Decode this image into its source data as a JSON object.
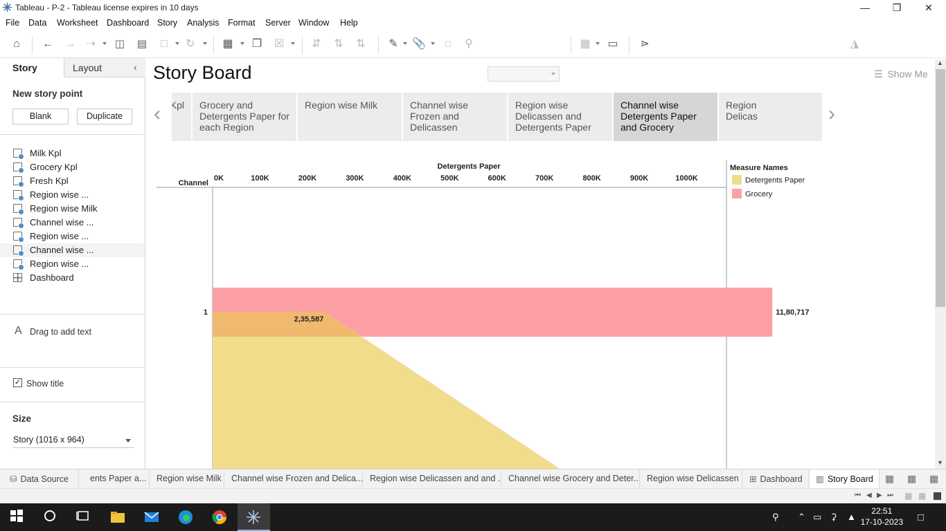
{
  "window": {
    "title": "Tableau - P-2 - Tableau license expires in 10 days",
    "minimize": "—",
    "restore": "❒",
    "close": "✕"
  },
  "menu": [
    "File",
    "Data",
    "Worksheet",
    "Dashboard",
    "Story",
    "Analysis",
    "Format",
    "Server",
    "Window",
    "Help"
  ],
  "toolbar": {
    "show_me_label": "Show Me"
  },
  "left_pane": {
    "tabs": {
      "story": "Story",
      "layout": "Layout"
    },
    "new_story_point": {
      "title": "New story point",
      "blank_label": "Blank",
      "duplicate_label": "Duplicate"
    },
    "sheets": [
      {
        "label": "Milk Kpl",
        "type": "worksheet"
      },
      {
        "label": "Grocery Kpl",
        "type": "worksheet"
      },
      {
        "label": "Fresh Kpl",
        "type": "worksheet"
      },
      {
        "label": "Region wise ...",
        "type": "worksheet"
      },
      {
        "label": "Region wise Milk",
        "type": "worksheet"
      },
      {
        "label": "Channel wise ...",
        "type": "worksheet"
      },
      {
        "label": "Region wise ...",
        "type": "worksheet"
      },
      {
        "label": "Channel wise ...",
        "type": "worksheet",
        "active": true
      },
      {
        "label": "Region wise ...",
        "type": "worksheet"
      },
      {
        "label": "Dashboard",
        "type": "dashboard"
      }
    ],
    "drag_text": "Drag to add text",
    "drag_text_icon": "A",
    "show_title": {
      "label": "Show title",
      "checked": true,
      "mark": "✓"
    },
    "size": {
      "title": "Size",
      "value": "Story (1016 x 964)"
    }
  },
  "story": {
    "title": "Story Board",
    "points": [
      {
        "label": "Fresh Kpl",
        "shown": "resh Kpl"
      },
      {
        "label": "Grocery and Detergents Paper for each Region"
      },
      {
        "label": "Region wise Milk"
      },
      {
        "label": "Channel wise Frozen and Delicassen"
      },
      {
        "label": "Region wise Delicassen and Detergents Paper"
      },
      {
        "label": "Channel wise Detergents Paper and Grocery",
        "active": true
      },
      {
        "label": "Region wise Delicassen",
        "shown": "Region\nDelicas"
      }
    ],
    "prev_arrow": "‹",
    "next_arrow": "›"
  },
  "chart_data": {
    "type": "bar",
    "title": "Detergents Paper",
    "row_header": "Channel",
    "x_ticks": [
      "0K",
      "100K",
      "200K",
      "300K",
      "400K",
      "500K",
      "600K",
      "700K",
      "800K",
      "900K",
      "1000K"
    ],
    "xlim": [
      0,
      1000000
    ],
    "categories": [
      "1"
    ],
    "series": [
      {
        "name": "Grocery",
        "values": [
          1180717
        ],
        "label": "11,80,717",
        "color": "#fca0a6"
      },
      {
        "name": "Detergents Paper",
        "values": [
          235587
        ],
        "label": "2,35,587",
        "color": "#f1dc8c"
      }
    ],
    "legend": {
      "title": "Measure Names",
      "placement": "right"
    }
  },
  "bottom_tabs": [
    {
      "label": "Data Source",
      "icon": "database-icon"
    },
    {
      "label": "ents Paper a..."
    },
    {
      "label": "Region wise Milk"
    },
    {
      "label": "Channel wise Frozen and Delica..."
    },
    {
      "label": "Region wise Delicassen and and ..."
    },
    {
      "label": "Channel wise Grocery and Deter..."
    },
    {
      "label": "Region wise Delicassen"
    },
    {
      "label": "Dashboard",
      "icon": "dashboard-icon"
    },
    {
      "label": "Story Board",
      "icon": "story-icon",
      "active": true
    }
  ],
  "taskbar": {
    "time": "22:51",
    "date": "17-10-2023"
  }
}
